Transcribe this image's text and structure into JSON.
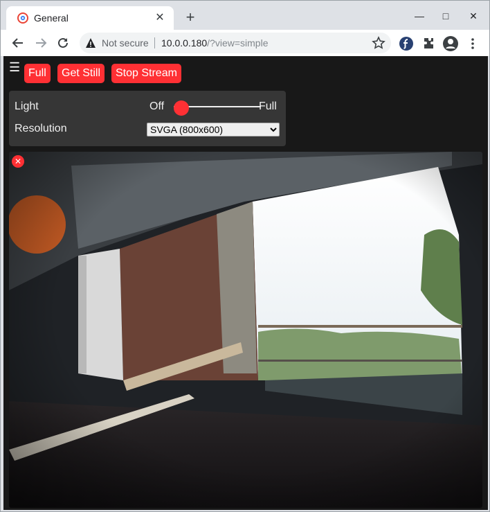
{
  "browser": {
    "tab_title": "General",
    "tab_close": "✕",
    "new_tab": "+",
    "minimize": "—",
    "maximize": "□",
    "close": "✕",
    "security_label": "Not secure",
    "url_host": "10.0.0.180",
    "url_path": "/?view=simple"
  },
  "page": {
    "menu_icon": "☰",
    "buttons": {
      "full": "Full",
      "get_still": "Get Still",
      "stop_stream": "Stop Stream"
    },
    "controls": {
      "light_label": "Light",
      "light_min": "Off",
      "light_max": "Full",
      "light_value": 0,
      "resolution_label": "Resolution",
      "resolution_value": "SVGA (800x600)"
    },
    "stream_close": "✕"
  },
  "colors": {
    "accent": "#ff3034",
    "page_bg": "#181818",
    "panel_bg": "#363636",
    "text": "#efefef"
  }
}
